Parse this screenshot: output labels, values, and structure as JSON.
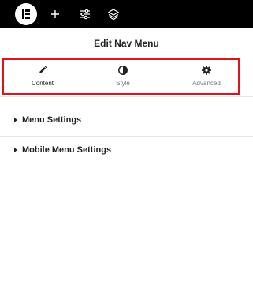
{
  "toolbar": {
    "icons": [
      "elementor-logo-icon",
      "add-icon",
      "sliders-icon",
      "layers-icon"
    ]
  },
  "panel": {
    "title": "Edit Nav Menu"
  },
  "tabs": [
    {
      "label": "Content",
      "icon": "pencil-icon",
      "active": true
    },
    {
      "label": "Style",
      "icon": "contrast-icon",
      "active": false
    },
    {
      "label": "Advanced",
      "icon": "gear-icon",
      "active": false
    }
  ],
  "sections": [
    {
      "label": "Menu Settings"
    },
    {
      "label": "Mobile Menu Settings"
    }
  ],
  "colors": {
    "topbar": "#000000",
    "highlight": "#e0131d",
    "text": "#1f2124",
    "muted": "#6d7882"
  }
}
